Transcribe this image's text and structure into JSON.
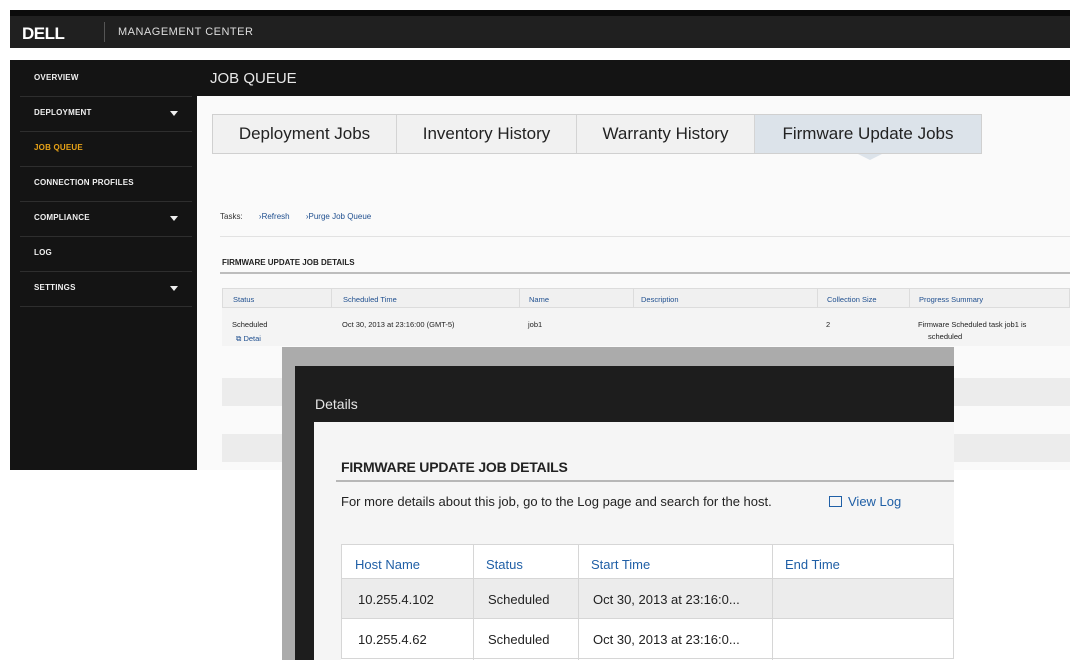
{
  "header": {
    "logo": "DELL",
    "product_name": "MANAGEMENT CENTER"
  },
  "sidebar": {
    "items": [
      {
        "label": "OVERVIEW",
        "expandable": false
      },
      {
        "label": "DEPLOYMENT",
        "expandable": true
      },
      {
        "label": "JOB QUEUE",
        "expandable": false,
        "active": true
      },
      {
        "label": "CONNECTION PROFILES",
        "expandable": false
      },
      {
        "label": "COMPLIANCE",
        "expandable": true
      },
      {
        "label": "LOG",
        "expandable": false
      },
      {
        "label": "SETTINGS",
        "expandable": true
      }
    ]
  },
  "page": {
    "title": "JOB QUEUE"
  },
  "tabs": [
    {
      "label": "Deployment Jobs"
    },
    {
      "label": "Inventory History"
    },
    {
      "label": "Warranty History"
    },
    {
      "label": "Firmware Update Jobs",
      "selected": true
    }
  ],
  "tasks": {
    "label": "Tasks:",
    "links": [
      "Refresh",
      "Purge Job Queue"
    ]
  },
  "job_details": {
    "section_title": "FIRMWARE UPDATE JOB DETAILS",
    "columns": [
      "Status",
      "Scheduled Time",
      "Name",
      "Description",
      "Collection Size",
      "Progress Summary"
    ],
    "rows": [
      {
        "status": "Scheduled",
        "scheduled_time": "Oct 30, 2013 at 23:16:00 (GMT-5)",
        "name": "job1",
        "description": "",
        "collection_size": "2",
        "progress_summary": "Firmware Scheduled task job1 is",
        "progress_summary_2": "scheduled",
        "details_link": "Detai"
      }
    ]
  },
  "dialog": {
    "title": "Details",
    "section_title": "FIRMWARE UPDATE JOB DETAILS",
    "note": "For more details about this job, go to the Log page and search for the host.",
    "view_log_label": "View Log",
    "columns": [
      "Host Name",
      "Status",
      "Start Time",
      "End Time"
    ],
    "rows": [
      {
        "host": "10.255.4.102",
        "status": "Scheduled",
        "start": "Oct 30, 2013 at 23:16:0...",
        "end": ""
      },
      {
        "host": "10.255.4.62",
        "status": "Scheduled",
        "start": "Oct 30, 2013 at 23:16:0...",
        "end": ""
      }
    ]
  },
  "colors": {
    "accent_active": "#e8a317",
    "link": "#1f5fa6",
    "dark_bg": "#141414",
    "selected_tab": "#dce3ea"
  }
}
